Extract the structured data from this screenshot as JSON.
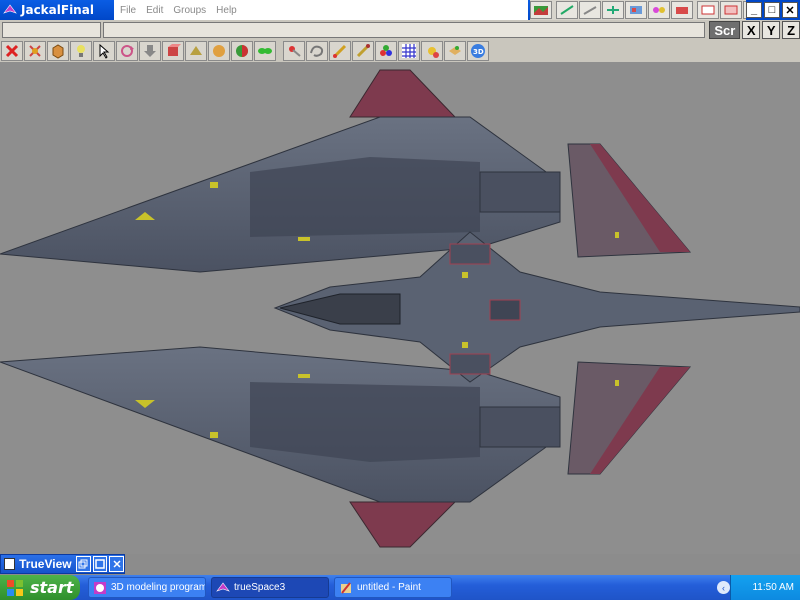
{
  "window": {
    "title": "JackalFinal",
    "menu": [
      "File",
      "Edit",
      "Groups",
      "Help"
    ],
    "controls": {
      "minimize": "_",
      "maximize": "□",
      "close": "✕"
    }
  },
  "axis_bar": {
    "scr": "Scr",
    "x": "X",
    "y": "Y",
    "z": "Z"
  },
  "toolbar": {
    "items": [
      "delete-x",
      "delete-red",
      "cube",
      "light",
      "pointer",
      "rotate",
      "down-arrow",
      "object",
      "cylinder",
      "sphere",
      "color",
      "node",
      "pin",
      "lasso",
      "paint",
      "brush",
      "spheres",
      "grid",
      "sun",
      "box",
      "3d"
    ]
  },
  "trueview": {
    "title": "TrueView"
  },
  "taskbar": {
    "start": "start",
    "tasks": [
      {
        "label": "3D modeling program..."
      },
      {
        "label": "trueSpace3"
      },
      {
        "label": "untitled - Paint"
      }
    ],
    "clock": "11:50 AM",
    "tray_chevron": "‹"
  },
  "colors": {
    "titlebar": "#0a5de4",
    "viewport": "#8e8e8e",
    "hull": "#5a6272",
    "hull_dark": "#3f4554",
    "wing_red": "#7e3a4e",
    "accent_yellow": "#c8c22a"
  }
}
